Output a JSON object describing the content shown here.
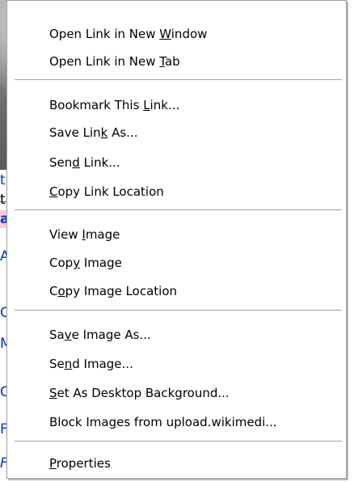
{
  "page_background": {
    "text_fragments": [
      "ti",
      "ti",
      "a",
      "A",
      "C",
      "M",
      "C",
      "F",
      "F"
    ]
  },
  "context_menu": {
    "groups": [
      [
        {
          "pre": "Open Link in New ",
          "key": "W",
          "post": "indow"
        },
        {
          "pre": "Open Link in New ",
          "key": "T",
          "post": "ab"
        }
      ],
      [
        {
          "pre": "Bookmark This ",
          "key": "L",
          "post": "ink..."
        },
        {
          "pre": "Save Lin",
          "key": "k",
          "post": " As..."
        },
        {
          "pre": "Sen",
          "key": "d",
          "post": " Link..."
        },
        {
          "pre": "",
          "key": "C",
          "post": "opy Link Location"
        }
      ],
      [
        {
          "pre": "View ",
          "key": "I",
          "post": "mage"
        },
        {
          "pre": "Cop",
          "key": "y",
          "post": " Image"
        },
        {
          "pre": "C",
          "key": "o",
          "post": "py Image Location"
        }
      ],
      [
        {
          "pre": "Sa",
          "key": "v",
          "post": "e Image As..."
        },
        {
          "pre": "Se",
          "key": "n",
          "post": "d Image..."
        },
        {
          "pre": "",
          "key": "S",
          "post": "et As Desktop Background..."
        },
        {
          "pre": "Block Ima",
          "key": "g",
          "post": "es from upload.wikimedi..."
        }
      ],
      [
        {
          "pre": "",
          "key": "P",
          "post": "roperties"
        }
      ]
    ]
  },
  "colors": {
    "menu_background": "#ffffff",
    "menu_border": "#9d9d9d",
    "separator": "#a6a6a6",
    "menu_text": "#000000",
    "page_link": "#0033cc",
    "page_highlight": "#ffc8d8"
  }
}
